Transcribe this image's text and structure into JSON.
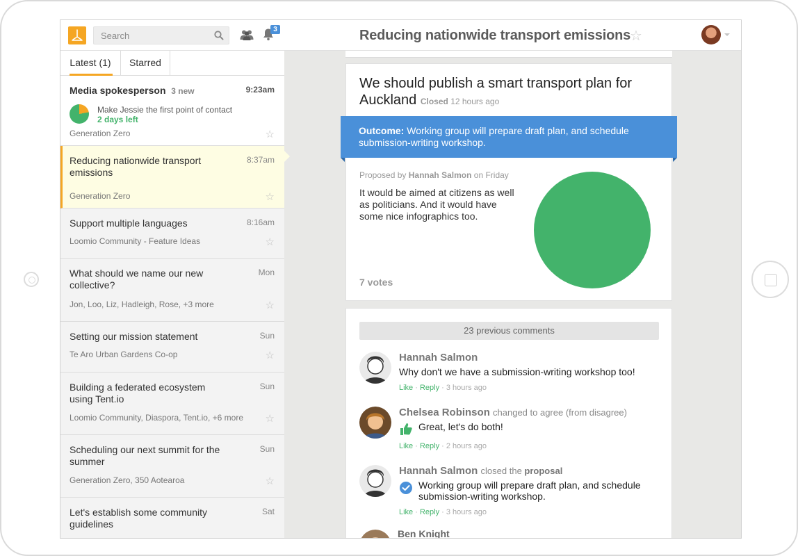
{
  "header": {
    "search_placeholder": "Search",
    "notification_count": "3",
    "page_title": "Reducing nationwide transport emissions"
  },
  "sidebar": {
    "tabs": [
      {
        "label": "Latest (1)",
        "active": true
      },
      {
        "label": "Starred",
        "active": false
      }
    ],
    "items": [
      {
        "title": "Media spokesperson",
        "new_count": "3 new",
        "time": "9:23am",
        "proposal": "Make Jessie the first point of contact",
        "due": "2 days left",
        "group": "Generation Zero"
      },
      {
        "title": "Reducing nationwide transport emissions",
        "time": "8:37am",
        "group": "Generation Zero",
        "selected": true
      },
      {
        "title": "Support multiple languages",
        "time": "8:16am",
        "group": "Loomio Community - Feature Ideas"
      },
      {
        "title": "What should we name our new collective?",
        "time": "Mon",
        "group": "Jon, Loo, Liz, Hadleigh, Rose, +3 more"
      },
      {
        "title": "Setting our mission statement",
        "time": "Sun",
        "group": "Te Aro Urban Gardens Co-op"
      },
      {
        "title": "Building a federated ecosystem using Tent.io",
        "time": "Sun",
        "group": "Loomio Community, Diaspora, Tent.io, +6 more"
      },
      {
        "title": "Scheduling our next summit for the summer",
        "time": "Sun",
        "group": "Generation Zero, 350 Aotearoa"
      },
      {
        "title": "Let's establish some community guidelines",
        "time": "Sat",
        "group": ""
      }
    ]
  },
  "proposal": {
    "title": "We should publish a smart transport plan for Auckland",
    "status": "Closed",
    "status_time": "12 hours ago",
    "outcome_label": "Outcome:",
    "outcome_text": "Working group will prepare draft plan, and schedule submission-writing workshop.",
    "proposed_by_prefix": "Proposed by",
    "proposed_by_name": "Hannah Salmon",
    "proposed_by_suffix": "on Friday",
    "description": "It would be aimed at citizens as well as politicians. And it would have some nice infographics too.",
    "votes": "7 votes",
    "vote_color": "#43b36b"
  },
  "comments": {
    "previous": "23 previous comments",
    "like_label": "Like",
    "reply_label": "Reply",
    "items": [
      {
        "author": "Hannah Salmon",
        "action": "",
        "text": "Why don't we have a submission-writing workshop too!",
        "time": "3 hours ago",
        "icon": ""
      },
      {
        "author": "Chelsea Robinson",
        "action": "changed to agree (from disagree)",
        "text": "Great, let's do both!",
        "time": "2 hours ago",
        "icon": "thumbs-up-icon"
      },
      {
        "author": "Hannah Salmon",
        "action_pre": "closed the",
        "action_bold": "proposal",
        "text": "Working group will prepare draft plan, and schedule submission-writing workshop.",
        "time": "3 hours ago",
        "icon": "check-circle-icon"
      },
      {
        "author": "Ben Knight",
        "action": "",
        "text": "",
        "time": "",
        "icon": ""
      }
    ]
  },
  "colors": {
    "accent": "#f5a623",
    "outcome": "#4a90d9",
    "agree": "#43b36b",
    "abstain": "#f5a623"
  }
}
